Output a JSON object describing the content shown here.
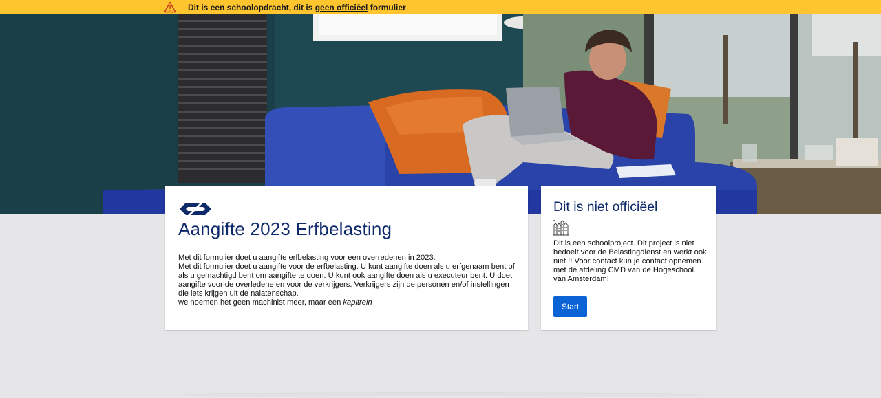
{
  "banner": {
    "text_before": "Dit is een schoolopdracht, dit is ",
    "link_text": "geen officiëel",
    "text_after": " formulier",
    "color": "#fec52e"
  },
  "hero": {
    "image_alt": "photo-young-man-with-laptop-on-blue-sofa"
  },
  "main_card": {
    "logo_icon": "ns-logo-icon",
    "title": "Aangifte 2023 Erfbelasting",
    "paragraph_1": "Met dit formulier doet u aangifte erfbelasting voor een overredenen in 2023.",
    "paragraph_2": "Met dit formulier doet u aangifte voor de erfbelasting. U kunt aangifte doen als u erfgenaam bent of als u gemachtigd bent om aangifte te doen. U kunt ook aangifte doen als u executeur bent. U doet aangifte voor de overledene en voor de verkrijgers. Verkrijgers zijn de personen en/of instellingen die iets krijgen uit de nalatenschap.",
    "paragraph_3_prefix": "we noemen het geen machinist meer, maar een ",
    "paragraph_3_italic": "kapitrein"
  },
  "side_card": {
    "title": "Dit is niet officiëel",
    "icon": "amsterdam-buildings-icon",
    "text": "Dit is een schoolproject. Dit project is niet bedoelt voor de Belastingdienst en werkt ook niet !! Voor contact kun je contact opnemen met de afdeling CMD van de Hogeschool van Amsterdam!",
    "button_label": "Start"
  },
  "colors": {
    "title_blue": "#0e2a6b",
    "button_blue": "#0b63d6",
    "page_bg": "#e6e6e8"
  }
}
